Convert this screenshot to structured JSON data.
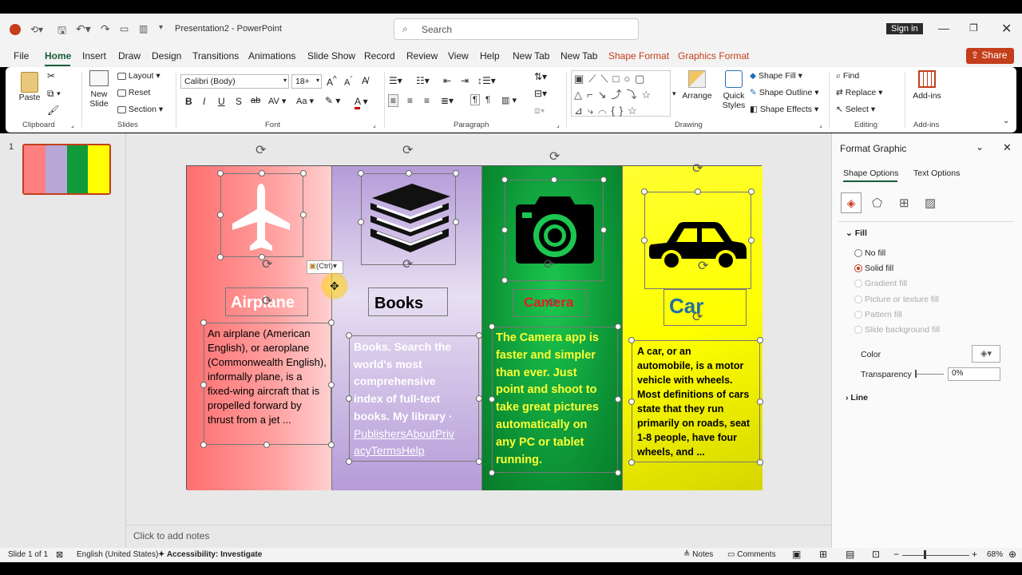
{
  "titlebar": {
    "doc_title": "Presentation2 - PowerPoint",
    "search_placeholder": "Search",
    "sign_in": "Sign in"
  },
  "menu": {
    "tabs": [
      "File",
      "Home",
      "Insert",
      "Draw",
      "Design",
      "Transitions",
      "Animations",
      "Slide Show",
      "Record",
      "Review",
      "View",
      "Help",
      "New Tab",
      "New Tab",
      "Shape Format",
      "Graphics Format"
    ],
    "active": "Home",
    "share": "Share"
  },
  "ribbon": {
    "clipboard": {
      "paste": "Paste",
      "label": "Clipboard"
    },
    "slides": {
      "new_slide": "New Slide",
      "layout": "Layout",
      "reset": "Reset",
      "section": "Section",
      "label": "Slides"
    },
    "font": {
      "name": "Calibri (Body)",
      "size": "18+",
      "label": "Font"
    },
    "paragraph": {
      "label": "Paragraph"
    },
    "drawing": {
      "arrange": "Arrange",
      "quick_styles": "Quick Styles",
      "shape_fill": "Shape Fill",
      "shape_outline": "Shape Outline",
      "shape_effects": "Shape Effects",
      "label": "Drawing"
    },
    "editing": {
      "find": "Find",
      "replace": "Replace",
      "select": "Select",
      "label": "Editing"
    },
    "addins": {
      "button": "Add-ins",
      "label": "Add-ins"
    }
  },
  "thumbnail": {
    "number": "1"
  },
  "slide": {
    "airplane": {
      "title": "Airplane",
      "body": "An airplane (American English), or aeroplane (Commonwealth English), informally plane, is a fixed-wing aircraft that is propelled forward by thrust from a jet ...",
      "colors": {
        "bg": "#ff7f7f"
      }
    },
    "books": {
      "title": "Books",
      "body": "Books. Search the world's most comprehensive index of full-text books. My library · PublishersAboutPrivacyTermsHelp",
      "body_lines": [
        "Books. Search the",
        "world's most",
        "comprehensive",
        "index of full-text",
        "books. My library ·",
        "PublishersAboutPriv",
        "acyTermsHelp"
      ]
    },
    "camera": {
      "title": "Camera",
      "body_lines": [
        "The Camera app is",
        "faster and simpler",
        "than ever. Just",
        "point and shoot to",
        "take great pictures",
        "automatically on",
        "any PC or tablet",
        "running."
      ]
    },
    "car": {
      "title": "Car",
      "body_lines": [
        "A car, or an",
        "automobile, is a motor",
        "vehicle with wheels.",
        "Most definitions of cars",
        "state that they run",
        "primarily on roads, seat",
        "1-8 people, have four",
        "wheels, and ..."
      ]
    },
    "paste_tag": "(Ctrl)"
  },
  "notes_placeholder": "Click to add notes",
  "format_pane": {
    "title": "Format Graphic",
    "tab_shape": "Shape Options",
    "tab_text": "Text Options",
    "fill_header": "Fill",
    "options": [
      "No fill",
      "Solid fill",
      "Gradient fill",
      "Picture or texture fill",
      "Pattern fill",
      "Slide background fill"
    ],
    "color_label": "Color",
    "transparency_label": "Transparency",
    "transparency_value": "0%",
    "line_header": "Line"
  },
  "status": {
    "slide": "Slide 1 of 1",
    "language": "English (United States)",
    "accessibility": "Accessibility: Investigate",
    "notes": "Notes",
    "comments": "Comments",
    "zoom": "68%"
  }
}
